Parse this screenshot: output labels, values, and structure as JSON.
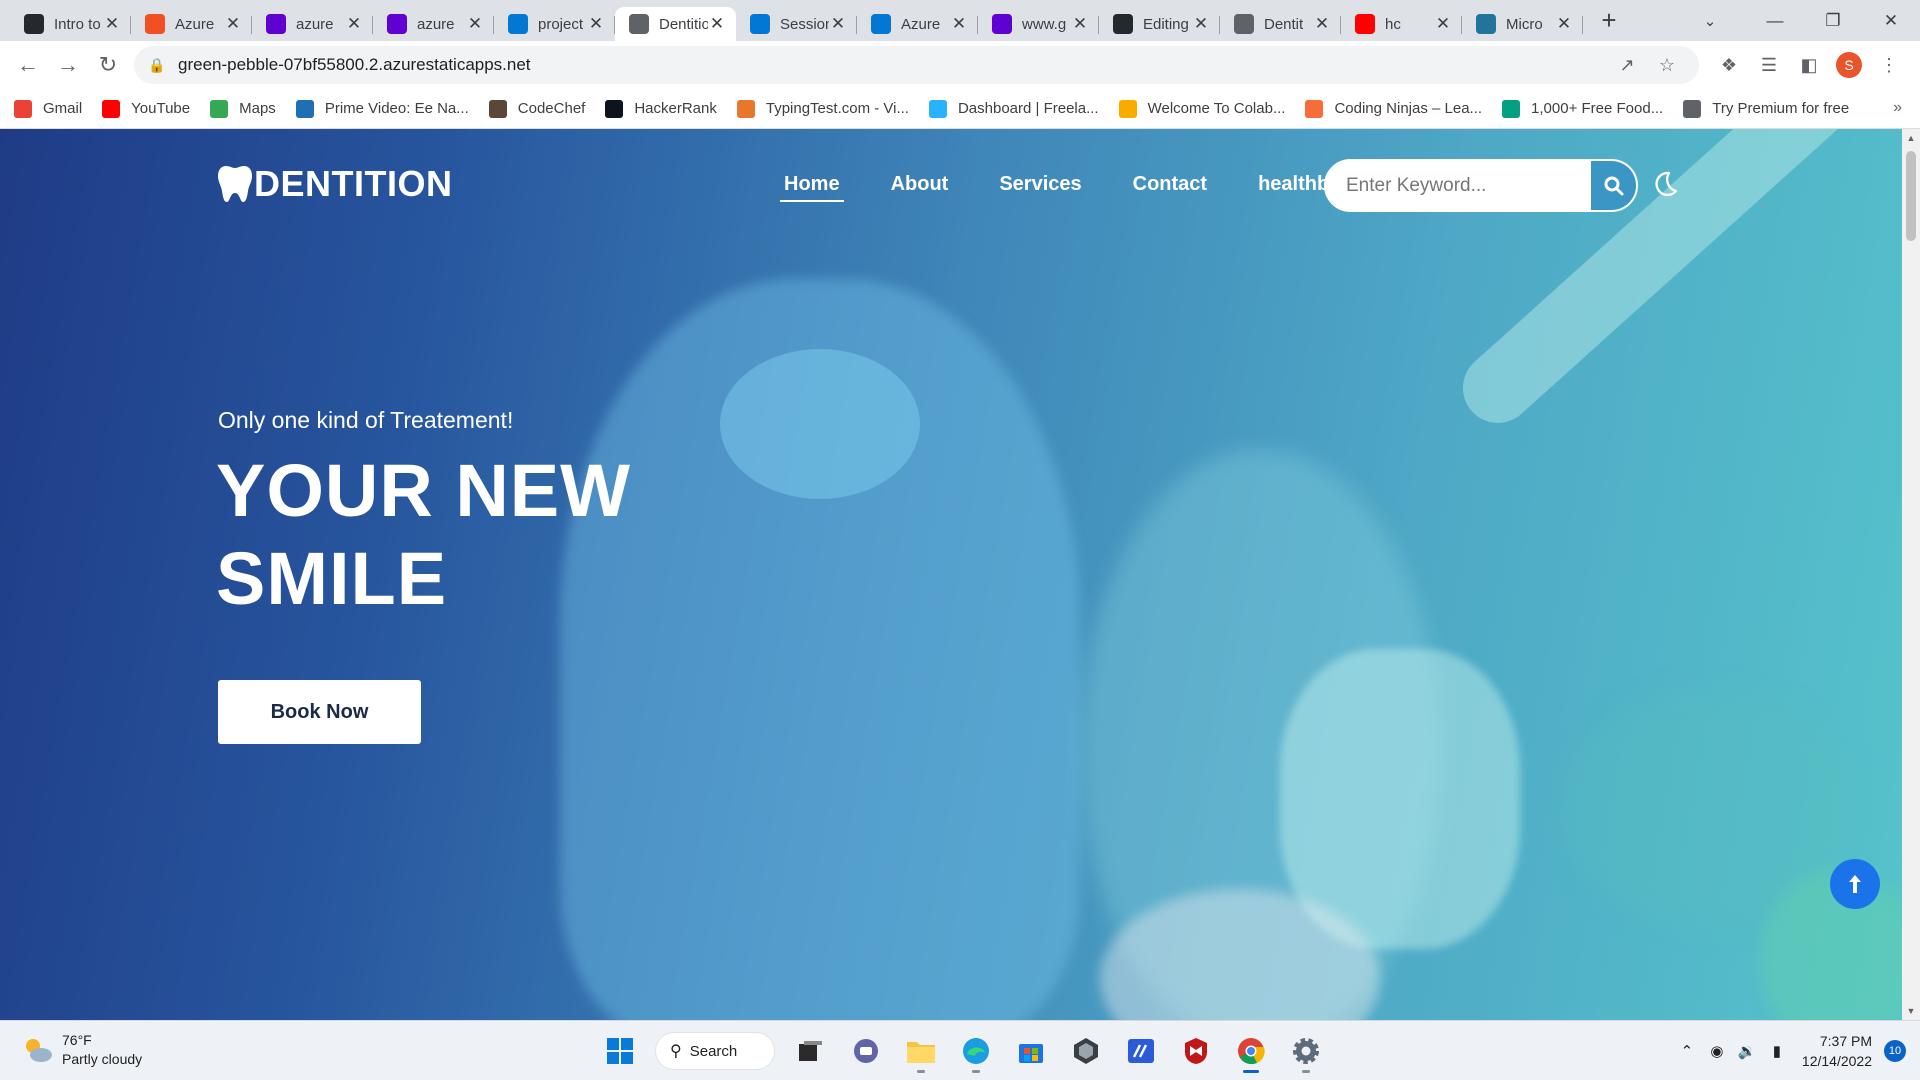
{
  "browser": {
    "tabs": [
      {
        "label": "Intro to",
        "favicon": "github-icon",
        "color": "#24292f"
      },
      {
        "label": "Azure",
        "favicon": "microsoft-icon",
        "color": "#f25022"
      },
      {
        "label": "azure",
        "favicon": "yahoo-icon",
        "color": "#6001d2"
      },
      {
        "label": "azure",
        "favicon": "yahoo-icon",
        "color": "#6001d2"
      },
      {
        "label": "project",
        "favicon": "azure-icon",
        "color": "#0078d4"
      },
      {
        "label": "Dentition",
        "favicon": "globe-icon",
        "color": "#5f6368",
        "active": true
      },
      {
        "label": "Session",
        "favicon": "azure-icon",
        "color": "#0078d4"
      },
      {
        "label": "Azure",
        "favicon": "azure-ad-icon",
        "color": "#0078d4"
      },
      {
        "label": "www.g",
        "favicon": "yahoo-icon",
        "color": "#6001d2"
      },
      {
        "label": "Editing",
        "favicon": "github-icon",
        "color": "#24292f"
      },
      {
        "label": "Dentit",
        "favicon": "globe-icon",
        "color": "#5f6368"
      },
      {
        "label": "hc",
        "favicon": "youtube-icon",
        "color": "#ff0000"
      },
      {
        "label": "Micro",
        "favicon": "wordpress-icon",
        "color": "#21759b"
      }
    ],
    "url": "green-pebble-07bf55800.2.azurestaticapps.net",
    "profile_initial": "S",
    "bookmarks": [
      {
        "label": "Gmail",
        "icon": "gmail-icon",
        "color": "#ea4335"
      },
      {
        "label": "YouTube",
        "icon": "youtube-icon",
        "color": "#ff0000"
      },
      {
        "label": "Maps",
        "icon": "maps-icon",
        "color": "#34a853"
      },
      {
        "label": "Prime Video: Ee Na...",
        "icon": "prime-video-icon",
        "color": "#1f6fb5"
      },
      {
        "label": "CodeChef",
        "icon": "codechef-icon",
        "color": "#5b4638"
      },
      {
        "label": "HackerRank",
        "icon": "hackerrank-icon",
        "color": "#0e141e"
      },
      {
        "label": "TypingTest.com - Vi...",
        "icon": "typingtest-icon",
        "color": "#e8772e"
      },
      {
        "label": "Dashboard | Freela...",
        "icon": "freelancer-icon",
        "color": "#29b2fe"
      },
      {
        "label": "Welcome To Colab...",
        "icon": "colab-icon",
        "color": "#f9ab00"
      },
      {
        "label": "Coding Ninjas – Lea...",
        "icon": "coding-ninjas-icon",
        "color": "#f66c3b"
      },
      {
        "label": "1,000+ Free Food...",
        "icon": "pexels-icon",
        "color": "#05a081"
      },
      {
        "label": "Try Premium for free",
        "icon": "globe-icon",
        "color": "#5f6368"
      }
    ]
  },
  "site": {
    "logo": "DENTITION",
    "nav": [
      "Home",
      "About",
      "Services",
      "Contact",
      "healthbot"
    ],
    "search_placeholder": "Enter Keyword...",
    "kicker": "Only one kind of Treatement!",
    "headline_line1": "YOUR NEW",
    "headline_line2": "SMILE",
    "cta": "Book Now"
  },
  "taskbar": {
    "temperature": "76°F",
    "weather": "Partly cloudy",
    "search_label": "Search",
    "time": "7:37 PM",
    "date": "12/14/2022",
    "notifications": "10"
  }
}
